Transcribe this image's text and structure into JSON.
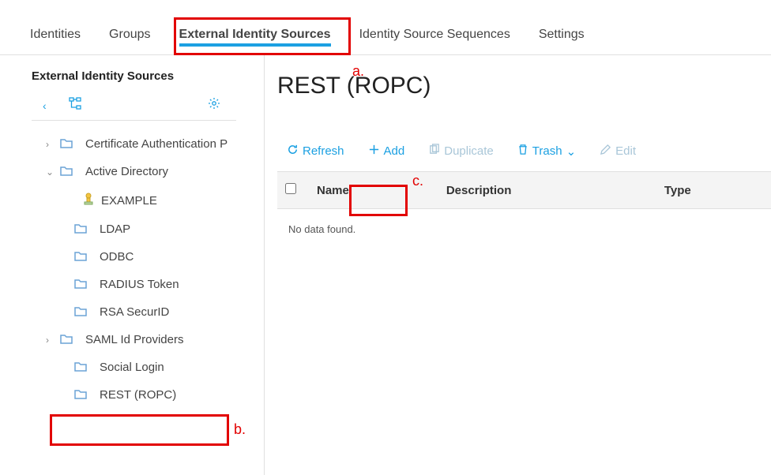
{
  "tabs": {
    "identities": "Identities",
    "groups": "Groups",
    "ext_identity_sources": "External Identity Sources",
    "identity_source_sequences": "Identity Source Sequences",
    "settings": "Settings"
  },
  "sidebar": {
    "title": "External Identity Sources",
    "items": {
      "cert_auth": "Certificate Authentication P",
      "active_directory": "Active Directory",
      "example": "EXAMPLE",
      "ldap": "LDAP",
      "odbc": "ODBC",
      "radius_token": "RADIUS Token",
      "rsa_securid": "RSA SecurID",
      "saml": "SAML Id Providers",
      "social_login": "Social Login",
      "rest_ropc": "REST (ROPC)"
    }
  },
  "content": {
    "title": "REST (ROPC)",
    "toolbar": {
      "refresh": "Refresh",
      "add": "Add",
      "duplicate": "Duplicate",
      "trash": "Trash",
      "edit": "Edit"
    },
    "columns": {
      "name": "Name",
      "description": "Description",
      "type": "Type"
    },
    "no_data": "No data found."
  },
  "annotations": {
    "a": "a.",
    "b": "b.",
    "c": "c."
  }
}
